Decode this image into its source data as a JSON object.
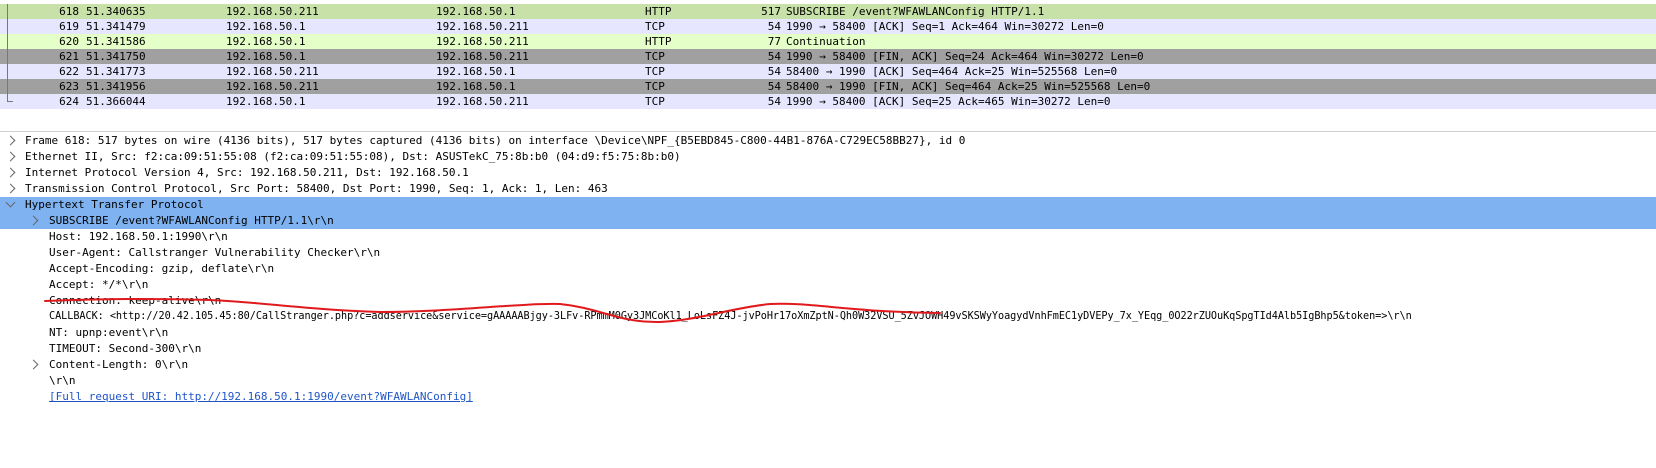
{
  "colors": {
    "http_row": "#e4ffc7",
    "http_row_selected": "#c8e1a9",
    "tcp_row": "#e7e6ff",
    "tcp_fin_row": "#a0a0a0",
    "selected_detail": "#7fb2f0",
    "annotation": "#e0191c"
  },
  "packets": [
    {
      "no": "618",
      "time": "51.340635",
      "src": "192.168.50.211",
      "dst": "192.168.50.1",
      "proto": "HTTP",
      "len": "517",
      "info": "SUBSCRIBE /event?WFAWLANConfig HTTP/1.1"
    },
    {
      "no": "619",
      "time": "51.341479",
      "src": "192.168.50.1",
      "dst": "192.168.50.211",
      "proto": "TCP",
      "len": "54",
      "info": "1990 → 58400 [ACK] Seq=1 Ack=464 Win=30272 Len=0"
    },
    {
      "no": "620",
      "time": "51.341586",
      "src": "192.168.50.1",
      "dst": "192.168.50.211",
      "proto": "HTTP",
      "len": "77",
      "info": "Continuation"
    },
    {
      "no": "621",
      "time": "51.341750",
      "src": "192.168.50.1",
      "dst": "192.168.50.211",
      "proto": "TCP",
      "len": "54",
      "info": "1990 → 58400 [FIN, ACK] Seq=24 Ack=464 Win=30272 Len=0"
    },
    {
      "no": "622",
      "time": "51.341773",
      "src": "192.168.50.211",
      "dst": "192.168.50.1",
      "proto": "TCP",
      "len": "54",
      "info": "58400 → 1990 [ACK] Seq=464 Ack=25 Win=525568 Len=0"
    },
    {
      "no": "623",
      "time": "51.341956",
      "src": "192.168.50.211",
      "dst": "192.168.50.1",
      "proto": "TCP",
      "len": "54",
      "info": "58400 → 1990 [FIN, ACK] Seq=464 Ack=25 Win=525568 Len=0"
    },
    {
      "no": "624",
      "time": "51.366044",
      "src": "192.168.50.1",
      "dst": "192.168.50.211",
      "proto": "TCP",
      "len": "54",
      "info": "1990 → 58400 [ACK] Seq=25 Ack=465 Win=30272 Len=0"
    }
  ],
  "details": {
    "frame": "Frame 618: 517 bytes on wire (4136 bits), 517 bytes captured (4136 bits) on interface \\Device\\NPF_{B5EBD845-C800-44B1-876A-C729EC58BB27}, id 0",
    "ethernet": "Ethernet II, Src: f2:ca:09:51:55:08 (f2:ca:09:51:55:08), Dst: ASUSTekC_75:8b:b0 (04:d9:f5:75:8b:b0)",
    "ip": "Internet Protocol Version 4, Src: 192.168.50.211, Dst: 192.168.50.1",
    "tcp": "Transmission Control Protocol, Src Port: 58400, Dst Port: 1990, Seq: 1, Ack: 1, Len: 463",
    "http": "Hypertext Transfer Protocol",
    "request_line": "SUBSCRIBE /event?WFAWLANConfig HTTP/1.1\\r\\n",
    "host": "Host: 192.168.50.1:1990\\r\\n",
    "user_agent": "User-Agent: Callstranger Vulnerability Checker\\r\\n",
    "accept_encoding": "Accept-Encoding: gzip, deflate\\r\\n",
    "accept": "Accept: */*\\r\\n",
    "connection": "Connection: keep-alive\\r\\n",
    "callback": "CALLBACK: <http://20.42.105.45:80/CallStranger.php?c=addservice&service=gAAAAABjgy-3LFv-RPmmM0Gy3JMCoKl1_LoLsFZ4J-jvPoHr17oXmZptN-Qh0W32VSU_5ZvJOWH49vSKSWyYoagydVnhFmEC1yDVEPy_7x_YEqg_0O22rZUOuKqSpgTId4Alb5IgBhp5&token=>\\r\\n",
    "nt": "NT: upnp:event\\r\\n",
    "timeout": "TIMEOUT: Second-300\\r\\n",
    "content_length": "Content-Length: 0\\r\\n",
    "crlf": "\\r\\n",
    "full_uri": "[Full request URI: http://192.168.50.1:1990/event?WFAWLANConfig]"
  }
}
